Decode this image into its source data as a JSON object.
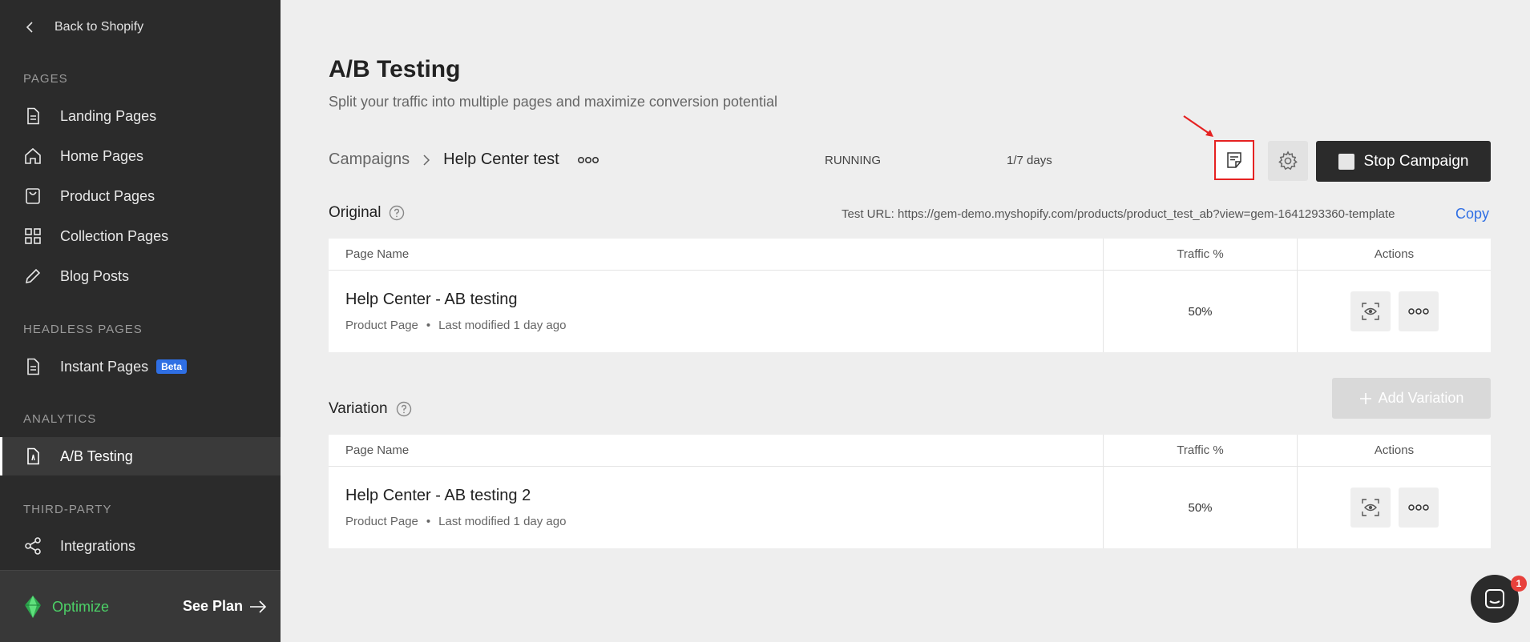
{
  "sidebar": {
    "back_label": "Back to Shopify",
    "sections": {
      "pages": "PAGES",
      "headless": "HEADLESS PAGES",
      "analytics": "ANALYTICS",
      "third_party": "THIRD-PARTY"
    },
    "items": [
      {
        "label": "Landing Pages",
        "icon": "page-icon"
      },
      {
        "label": "Home Pages",
        "icon": "home-icon"
      },
      {
        "label": "Product Pages",
        "icon": "bag-icon"
      },
      {
        "label": "Collection Pages",
        "icon": "grid-icon"
      },
      {
        "label": "Blog Posts",
        "icon": "pencil-icon"
      },
      {
        "label": "Instant Pages",
        "icon": "page-icon",
        "badge": "Beta"
      },
      {
        "label": "A/B Testing",
        "icon": "ab-test-icon",
        "active": true
      },
      {
        "label": "Integrations",
        "icon": "share-icon"
      }
    ],
    "footer": {
      "plan": "Optimize",
      "see_plan": "See Plan"
    }
  },
  "header": {
    "title": "A/B Testing",
    "subtitle": "Split your traffic into multiple pages and maximize conversion potential"
  },
  "breadcrumb": {
    "parent": "Campaigns",
    "current": "Help Center test"
  },
  "campaign": {
    "status": "RUNNING",
    "days": "1/7 days",
    "stop_label": "Stop Campaign"
  },
  "original": {
    "title": "Original",
    "test_url": "Test URL: https://gem-demo.myshopify.com/products/product_test_ab?view=gem-1641293360-template",
    "copy_label": "Copy",
    "columns": [
      "Page Name",
      "Traffic %",
      "Actions"
    ],
    "rows": [
      {
        "name": "Help Center - AB testing",
        "type": "Product Page",
        "modified": "Last modified 1 day ago",
        "traffic": "50%"
      }
    ]
  },
  "variation": {
    "title": "Variation",
    "add_label": "Add Variation",
    "columns": [
      "Page Name",
      "Traffic %",
      "Actions"
    ],
    "rows": [
      {
        "name": "Help Center - AB testing 2",
        "type": "Product Page",
        "modified": "Last modified 1 day ago",
        "traffic": "50%"
      }
    ]
  },
  "chat": {
    "badge": "1"
  },
  "colors": {
    "accent": "#2f6fe4",
    "highlight": "#e52222",
    "brand_green": "#4cd167"
  }
}
